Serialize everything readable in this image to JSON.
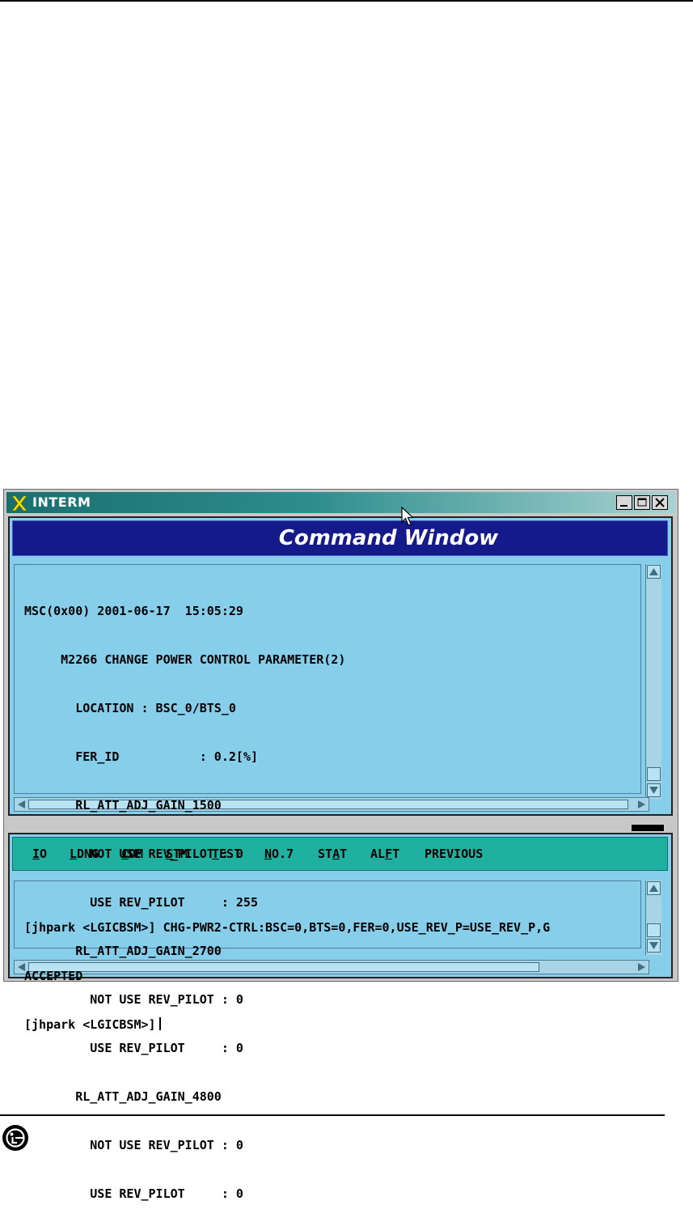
{
  "window": {
    "title": "INTERM"
  },
  "command_window": {
    "header": "Command Window",
    "output_lines": [
      "MSC(0x00) 2001-06-17  15:05:29",
      "     M2266 CHANGE POWER CONTROL PARAMETER(2)",
      "       LOCATION : BSC_0/BTS_0",
      "       FER_ID           : 0.2[%]",
      "       RL_ATT_ADJ_GAIN_1500",
      "         NOT USE REV_PILOT : 0",
      "         USE REV_PILOT     : 255",
      "       RL_ATT_ADJ_GAIN_2700",
      "         NOT USE REV_PILOT : 0",
      "         USE REV_PILOT     : 0",
      "       RL_ATT_ADJ_GAIN_4800",
      "         NOT USE REV_PILOT : 0",
      "         USE REV_PILOT     : 0"
    ]
  },
  "menu": {
    "items": [
      {
        "label": "IO",
        "hotkey_index": 0
      },
      {
        "label": "LDNG",
        "hotkey_index": 0
      },
      {
        "label": "CDM",
        "hotkey_index": 0
      },
      {
        "label": "STM",
        "hotkey_index": 0
      },
      {
        "label": "TEST",
        "hotkey_index": 0
      },
      {
        "label": "NO.7",
        "hotkey_index": 0
      },
      {
        "label": "STAT",
        "hotkey_index": 2
      },
      {
        "label": "ALFT",
        "hotkey_index": 2
      },
      {
        "label": "PREVIOUS",
        "hotkey_index": -1
      }
    ]
  },
  "command_input": {
    "lines": [
      "[jhpark <LGICBSM>] CHG-PWR2-CTRL:BSC=0,BTS=0,FER=0,USE_REV_P=USE_REV_P,G",
      "ACCEPTED",
      "[jhpark <LGICBSM>]"
    ]
  },
  "icons": {
    "app": "x-logo-icon",
    "minimize": "minimize-icon",
    "maximize": "maximize-icon",
    "close": "close-icon",
    "pointer": "mouse-pointer-icon",
    "brand": "lg-logo-icon"
  },
  "colors": {
    "pane_bg": "#87ceeb",
    "header_bg": "#151a8a",
    "menubar_bg": "#20b0a0",
    "titlebar_start": "#1a6f6f",
    "titlebar_end": "#a7d3d2"
  }
}
